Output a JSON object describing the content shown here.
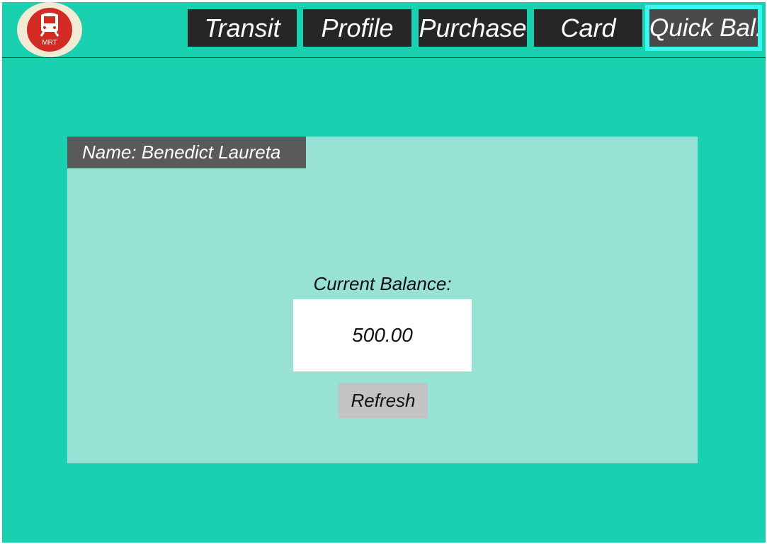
{
  "app": {
    "logo_text": "MRT",
    "colors": {
      "background": "#19d0b1",
      "panel": "#97e2d4",
      "nav_button": "#262626",
      "nav_active_outline": "#37f7ef",
      "logo_red": "#d42a24"
    }
  },
  "nav": {
    "items": [
      {
        "label": "Transit"
      },
      {
        "label": "Profile"
      },
      {
        "label": "Purchase"
      },
      {
        "label": "Card"
      },
      {
        "label": "Quick Bal.",
        "active": true
      }
    ]
  },
  "panel": {
    "name_label": "Name: Benedict Laureta",
    "balance_label": "Current Balance:",
    "balance_value": "500.00",
    "refresh_label": "Refresh"
  }
}
